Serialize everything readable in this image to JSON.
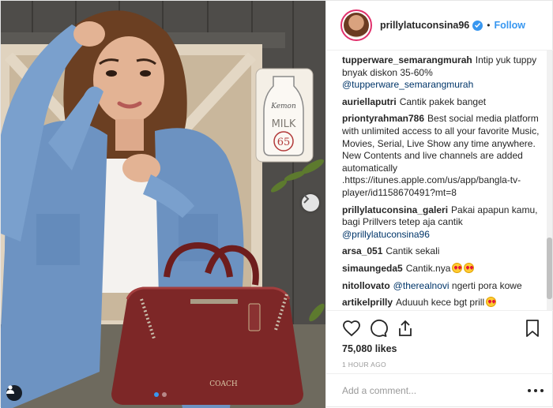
{
  "header": {
    "username": "prillylatuconsina96",
    "separator": "•",
    "follow_label": "Follow"
  },
  "photo": {
    "milk_sign_brand": "Kemon",
    "milk_sign_word": "MILK",
    "milk_sign_number": "65",
    "bag_brand": "COACH",
    "slides": 2,
    "active_slide": 1
  },
  "comments": [
    {
      "user": "tupperware_semarangmurah",
      "text": "Intip yuk tuppy bnyak diskon 35-60%",
      "mention": "@tupperware_semarangmurah",
      "after": "",
      "emoji": 0
    },
    {
      "user": "auriellaputri",
      "text": "Cantik pakek banget",
      "mention": "",
      "after": "",
      "emoji": 0
    },
    {
      "user": "priontyrahman786",
      "text": "Best social media platform with unlimited access to all your favorite Music, Movies, Serial, Live Show any time anywhere. New Contents and live channels are added automatically .https://itunes.apple.com/us/app/bangla-tv-player/id1158670491?mt=8",
      "mention": "",
      "after": "",
      "emoji": 0
    },
    {
      "user": "prillylatuconsina_galeri",
      "text": "Pakai apapun kamu, bagi Prillvers tetep aja cantik",
      "mention": "@prillylatuconsina96",
      "after": "",
      "emoji": 0
    },
    {
      "user": "arsa_051",
      "text": "Cantik sekali",
      "mention": "",
      "after": "",
      "emoji": 0
    },
    {
      "user": "simaungeda5",
      "text": "Cantik.nya",
      "mention": "",
      "after": "",
      "emoji": 2
    },
    {
      "user": "nitollovato",
      "text": "",
      "mention": "@therealnovi",
      "after": "ngerti pora kowe",
      "emoji": 0
    },
    {
      "user": "artikelprilly",
      "text": "Aduuuh kece bgt prill",
      "mention": "",
      "after": "",
      "emoji": 1
    }
  ],
  "actions": {
    "likes": "75,080 likes",
    "time": "1 HOUR AGO"
  },
  "add_comment": {
    "placeholder": "Add a comment..."
  },
  "icons": {
    "verified": "verified-badge-icon",
    "like": "heart-icon",
    "comment": "comment-bubble-icon",
    "share": "share-icon",
    "save": "bookmark-icon",
    "more": "more-options-icon",
    "next": "chevron-right-icon",
    "tag": "user-tag-icon"
  },
  "colors": {
    "accent": "#3897f0",
    "mention": "#003569",
    "text": "#262626",
    "muted": "#999999",
    "story_ring": "#e1306c"
  }
}
